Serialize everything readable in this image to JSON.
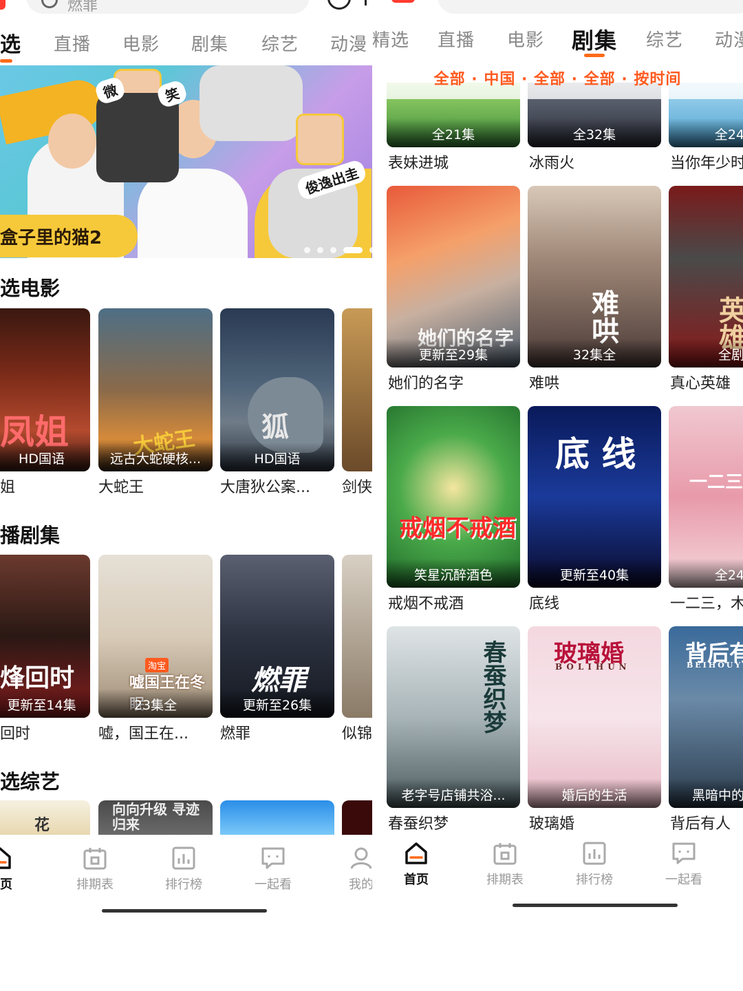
{
  "left": {
    "search_placeholder": "燃罪",
    "tabs": [
      "选",
      "直播",
      "电影",
      "剧集",
      "综艺",
      "动漫"
    ],
    "banner": {
      "title": "盒子里的猫2",
      "tag_left": "微",
      "tag_mid": "笑",
      "tag_right": "俊逸出圭"
    },
    "sections": {
      "movies": {
        "title": "选电影",
        "items": [
          {
            "label": "HD国语",
            "title": "姐",
            "art": "凤姐"
          },
          {
            "label": "远古大蛇硬核...",
            "title": "大蛇王",
            "art": "大蛇王"
          },
          {
            "label": "HD国语",
            "title": "大唐狄公案...",
            "art": "狐"
          },
          {
            "label": "",
            "title": "剑侠",
            "art": ""
          }
        ]
      },
      "series": {
        "title": "播剧集",
        "items": [
          {
            "label": "更新至14集",
            "title": "回时",
            "art": "烽回时"
          },
          {
            "label": "23集全",
            "title": "嘘，国王在...",
            "art": "嘘国王在冬眠",
            "badge": "淘宝"
          },
          {
            "label": "更新至26集",
            "title": "燃罪",
            "art": "燃罪"
          },
          {
            "label": "",
            "title": "似锦",
            "art": ""
          }
        ]
      },
      "variety": {
        "title": "选综艺",
        "items": [
          {
            "art": "花"
          },
          {
            "art": "向向升级 寻迹归来"
          },
          {
            "art": ""
          },
          {
            "art": ""
          }
        ]
      }
    },
    "bottom_nav": [
      "首页",
      "排期表",
      "排行榜",
      "一起看",
      "我的"
    ]
  },
  "right": {
    "tabs": [
      "精选",
      "直播",
      "电影",
      "剧集",
      "综艺",
      "动漫"
    ],
    "filter": "全部 · 中国 · 全部 · 全部 · 按时间",
    "rows": [
      [
        {
          "label": "全21集",
          "title": "表妹进城"
        },
        {
          "label": "全32集",
          "title": "冰雨火"
        },
        {
          "label": "全24",
          "title": "当你年少时"
        }
      ],
      [
        {
          "label": "更新至29集",
          "title": "她们的名字",
          "art": "她们的名字"
        },
        {
          "label": "32集全",
          "title": "难哄",
          "art": "难哄"
        },
        {
          "label": "全剧",
          "title": "真心英雄",
          "art": "真心英雄"
        }
      ],
      [
        {
          "label": "笑星沉醉酒色",
          "title": "戒烟不戒酒",
          "art": "戒烟不戒酒"
        },
        {
          "label": "更新至40集",
          "title": "底线",
          "art": "底 线"
        },
        {
          "label": "全24",
          "title": "一二三，木头人",
          "art": "一二三"
        }
      ],
      [
        {
          "label": "老字号店铺共浴...",
          "title": "春蚕织梦",
          "art": "春蚕织梦"
        },
        {
          "label": "婚后的生活",
          "title": "玻璃婚",
          "art": "玻璃婚",
          "art_sub": "BOLIHUN"
        },
        {
          "label": "黑暗中的",
          "title": "背后有人",
          "art": "背后有",
          "art_sub": "BEIHOUY"
        }
      ]
    ],
    "bottom_nav": [
      "首页",
      "排期表",
      "排行榜",
      "一起看"
    ]
  },
  "colors": {
    "accent": "#ff6a1a",
    "filter_text": "#ff5a1f",
    "active_text": "#111111",
    "inactive_text": "#888888"
  },
  "icons": [
    "home-icon",
    "calendar-icon",
    "chart-icon",
    "chat-icon",
    "user-icon",
    "search-icon"
  ]
}
